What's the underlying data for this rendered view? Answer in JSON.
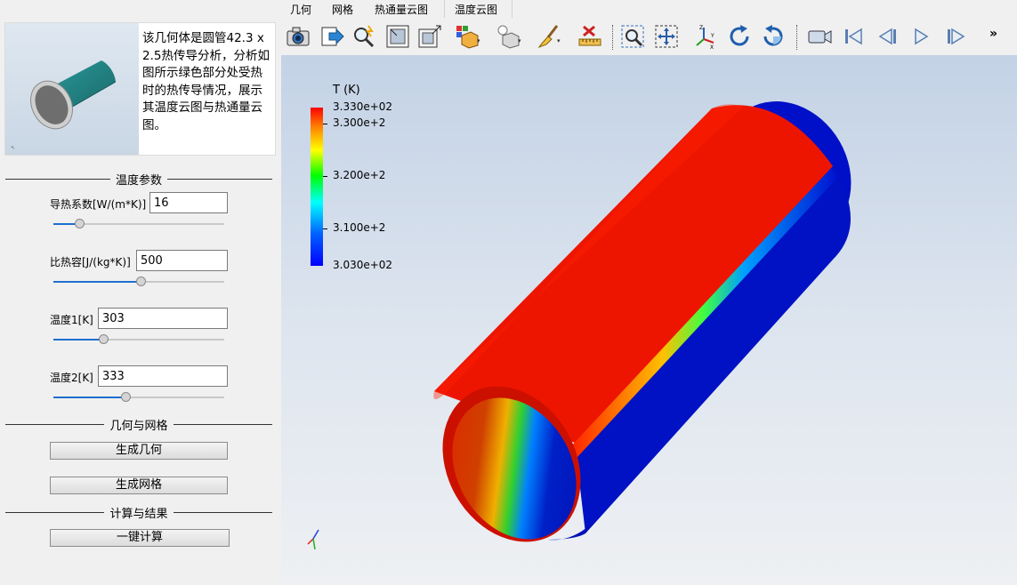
{
  "preview": {
    "description": "该几何体是圆管42.3 x 2.5热传导分析，分析如图所示绿色部分处受热时的热传导情况，展示其温度云图与热通量云图。"
  },
  "sections": {
    "temperature_params": "温度参数",
    "geometry_mesh": "几何与网格",
    "compute_results": "计算与结果"
  },
  "params": [
    {
      "label": "导热系数[W/(m*K)]",
      "value": "16",
      "slider_fraction": 0.15
    },
    {
      "label": "比热容[J/(kg*K)]",
      "value": "500",
      "slider_fraction": 0.51
    },
    {
      "label": "温度1[K]",
      "value": "303",
      "slider_fraction": 0.29
    },
    {
      "label": "温度2[K]",
      "value": "333",
      "slider_fraction": 0.42
    }
  ],
  "buttons": {
    "generate_geometry": "生成几何",
    "generate_mesh": "生成网格",
    "one_click_compute": "一键计算"
  },
  "menu": [
    "几何",
    "网格",
    "热通量云图",
    "温度云图"
  ],
  "toolbar": {
    "overflow": "»",
    "icons": [
      "camera-icon",
      "export-icon",
      "zoom-magic-icon",
      "fit-view-icon",
      "expand-view-icon",
      "color-object-icon",
      "light-object-icon",
      "brush-icon",
      "ruler-clear-icon",
      "zoom-box-icon",
      "pan-icon",
      "axes-icon",
      "rotate-cw-icon",
      "rotate-ccw-icon",
      "video-icon",
      "skip-first-icon",
      "step-back-icon",
      "play-icon",
      "skip-last-icon"
    ]
  },
  "legend": {
    "title": "T (K)",
    "max_label": "3.330e+02",
    "ticks": [
      {
        "label": "3.300e+2",
        "value": 330
      },
      {
        "label": "3.200e+2",
        "value": 320
      },
      {
        "label": "3.100e+2",
        "value": 310
      }
    ],
    "min_label": "3.030e+02",
    "range": [
      303,
      333
    ]
  },
  "colors": {
    "hot": "#ff1a00",
    "cold": "#0010c8",
    "accent": "#1e6fcf"
  }
}
